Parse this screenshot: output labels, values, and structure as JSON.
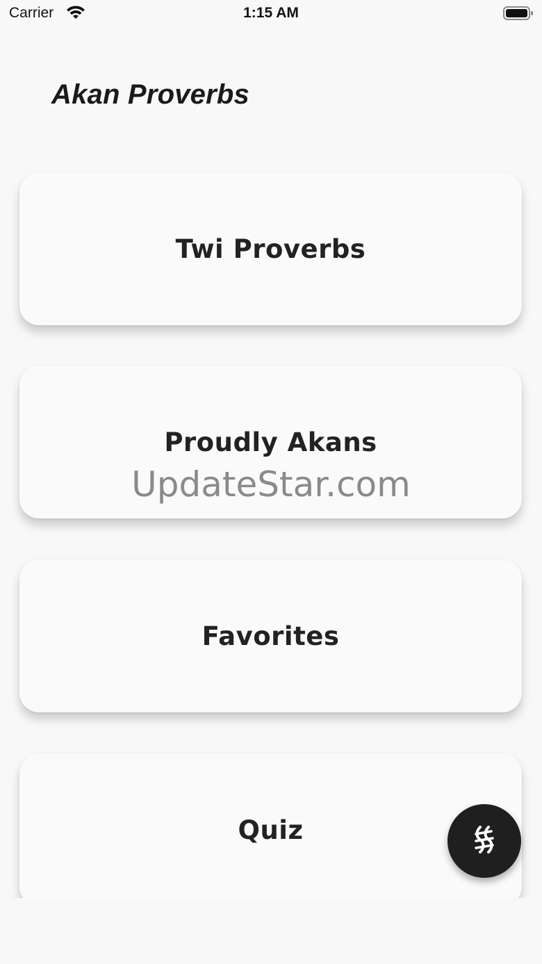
{
  "status_bar": {
    "carrier": "Carrier",
    "time": "1:15 AM",
    "wifi_icon": "wifi-icon",
    "battery_icon": "battery-icon"
  },
  "header": {
    "title": "Akan Proverbs"
  },
  "menu": {
    "items": [
      {
        "label": "Twi Proverbs"
      },
      {
        "label": "Proudly Akans"
      },
      {
        "label": "Favorites"
      },
      {
        "label": "Quiz"
      }
    ]
  },
  "watermark": {
    "text": "UpdateStar.com"
  },
  "fab": {
    "icon": "adinkra-symbol-icon",
    "color": "#1f1f1f"
  }
}
